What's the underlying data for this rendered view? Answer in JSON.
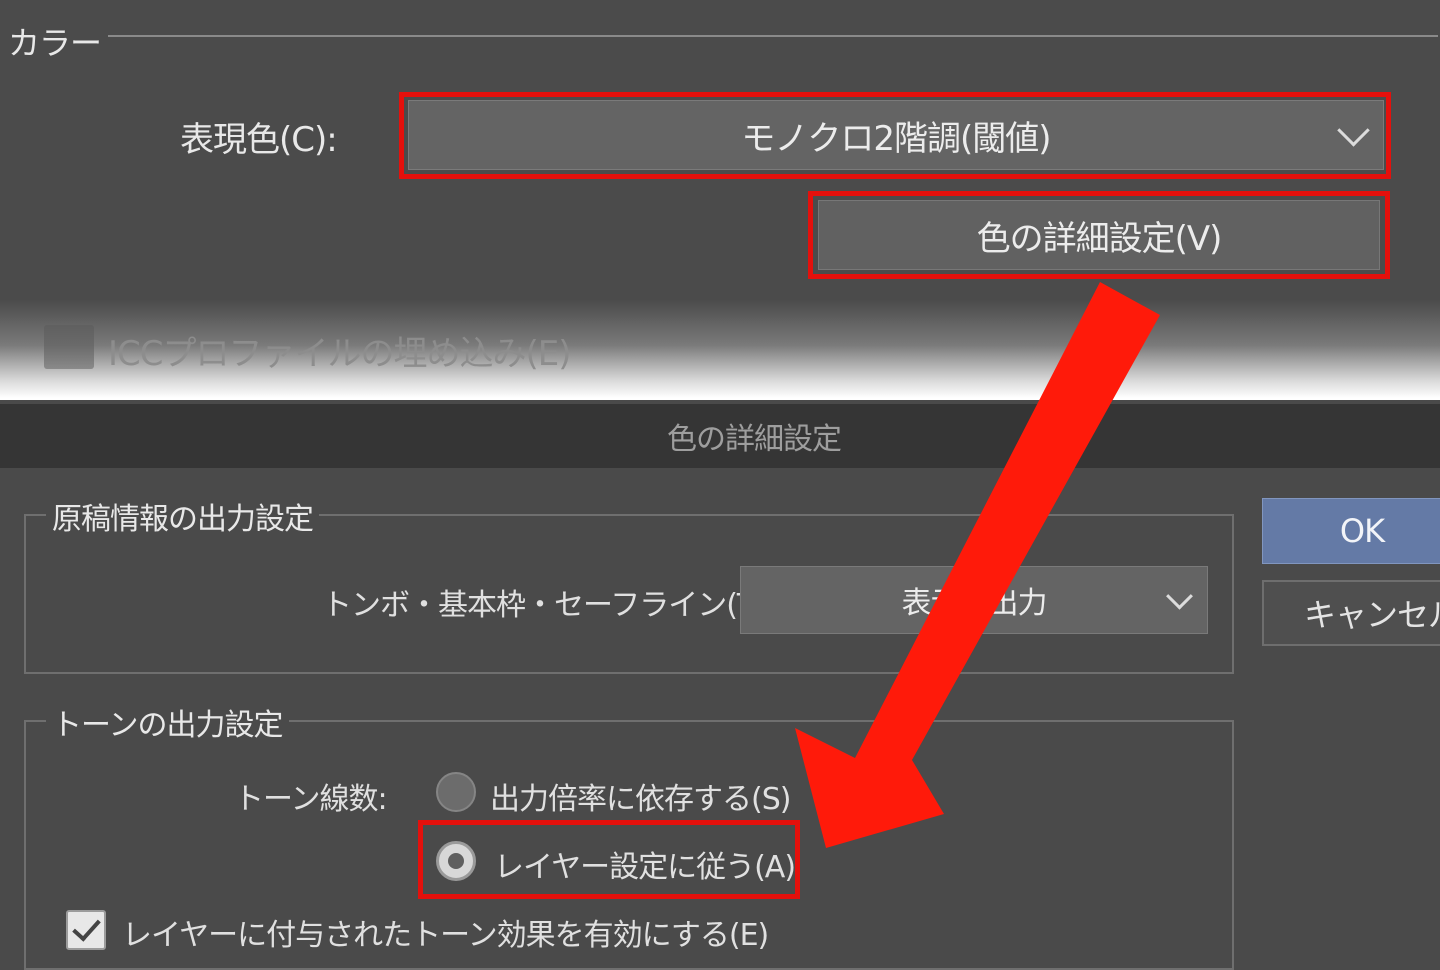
{
  "colors": {
    "highlight": "#e4100c",
    "arrow": "#ff1a0a",
    "ok_button": "#647aa6"
  },
  "top_panel": {
    "section_title": "カラー",
    "expression_color_label": "表現色(C):",
    "expression_color_value": "モノクロ2階調(閾値)",
    "detail_button_label": "色の詳細設定(V)",
    "icc_checkbox_label": "ICCプロファイルの埋め込み(E)"
  },
  "dialog": {
    "title": "色の詳細設定",
    "manuscript_group": {
      "title": "原稿情報の出力設定",
      "crop_marks_label": "トンボ・基本枠・セーフライン(T):",
      "crop_marks_value": "表示を出力"
    },
    "tone_group": {
      "title": "トーンの出力設定",
      "tone_lines_label": "トーン線数:",
      "radio_options": [
        {
          "label": "出力倍率に依存する(S)",
          "selected": false
        },
        {
          "label": "レイヤー設定に従う(A)",
          "selected": true
        }
      ],
      "tone_effect_checkbox_label": "レイヤーに付与されたトーン効果を有効にする(E)",
      "tone_effect_checked": true
    },
    "ok_button": "OK",
    "cancel_button": "キャンセル"
  },
  "icons": {
    "dropdown": "chevron-down-icon",
    "arrow": "red-arrow-icon"
  }
}
